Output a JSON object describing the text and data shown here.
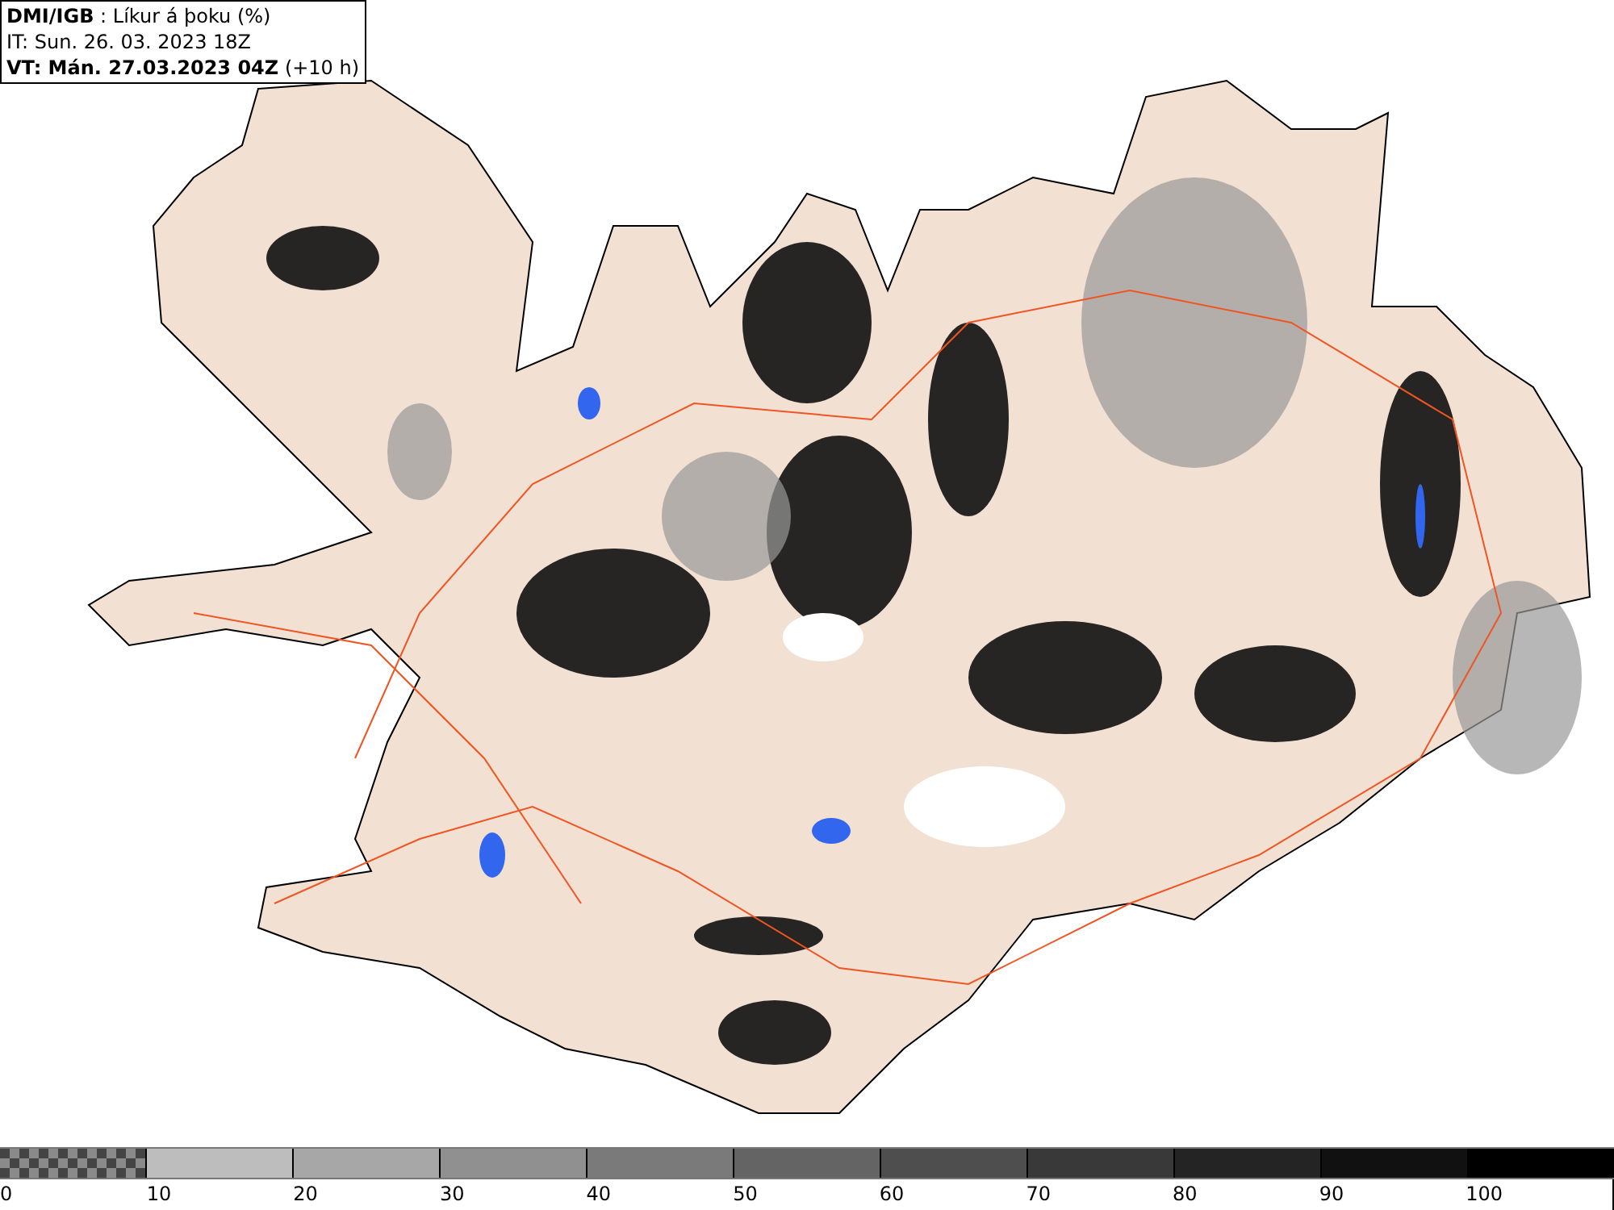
{
  "header": {
    "source": "DMI/IGB",
    "separator": " : ",
    "title": "Líkur á þoku (%)",
    "init_time": "IT: Sun. 26. 03. 2023 18Z",
    "valid_time": "VT: Mán. 27.03.2023 04Z",
    "lead": "(+10 h)"
  },
  "colorbar": {
    "segments": [
      {
        "kind": "checker",
        "color": "#8a8a8a",
        "label": "0"
      },
      {
        "kind": "solid",
        "color": "#bdbdbd",
        "label": "10"
      },
      {
        "kind": "solid",
        "color": "#a7a7a7",
        "label": "20"
      },
      {
        "kind": "solid",
        "color": "#909090",
        "label": "30"
      },
      {
        "kind": "solid",
        "color": "#7a7a7a",
        "label": "40"
      },
      {
        "kind": "solid",
        "color": "#646464",
        "label": "50"
      },
      {
        "kind": "solid",
        "color": "#4e4e4e",
        "label": "60"
      },
      {
        "kind": "solid",
        "color": "#393939",
        "label": "70"
      },
      {
        "kind": "solid",
        "color": "#242424",
        "label": "80"
      },
      {
        "kind": "solid",
        "color": "#111111",
        "label": "90"
      },
      {
        "kind": "solid",
        "color": "#000000",
        "label": "100"
      }
    ]
  }
}
